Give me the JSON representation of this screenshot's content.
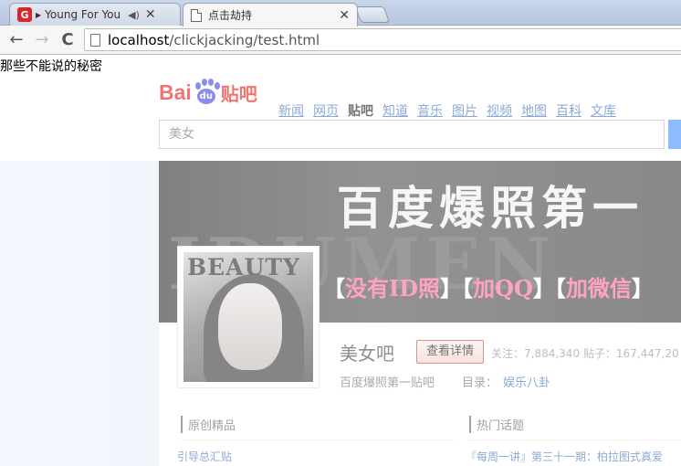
{
  "tabs": [
    {
      "fav": "G",
      "label": "Young For You"
    },
    {
      "label": "点击劫持"
    }
  ],
  "address_bar": {
    "host": "localhost",
    "path": "/clickjacking/test.html"
  },
  "page": {
    "secret_text": "那些不能说的秘密"
  },
  "baidu": {
    "logo_bai": "Bai",
    "logo_du": "du",
    "logo_tieba": "贴吧",
    "nav": [
      "新闻",
      "网页",
      "贴吧",
      "知道",
      "音乐",
      "图片",
      "视频",
      "地图",
      "百科",
      "文库"
    ],
    "search_value": "美女",
    "banner_bg_word": "IDUMEN",
    "banner_title": "百度爆照第一",
    "banner_tags": {
      "b1": "【",
      "t1": "没有ID照",
      "b2": "】【",
      "t2": "加QQ",
      "b3": "】【",
      "t3": "加微信",
      "b4": "】"
    },
    "cover_mag": "BEAUTY",
    "forum_name": "美女吧",
    "detail_button": "查看详情",
    "stats": "关注：7,884,340    贴子：167,447,20",
    "subtitle": "百度爆照第一贴吧",
    "catalog_label": "目录：",
    "catalog_value": "娱乐八卦",
    "section_left": "原创精品",
    "section_right": "热门话题",
    "link_left": "引导总汇贴",
    "link_right": "『每周一讲』第三十一期：柏拉图式真爱"
  },
  "colors": {
    "baidu_red": "#e10602",
    "baidu_blue": "#2932e1",
    "link": "#2d64b3",
    "pink_tag": "#ff5a8d"
  }
}
